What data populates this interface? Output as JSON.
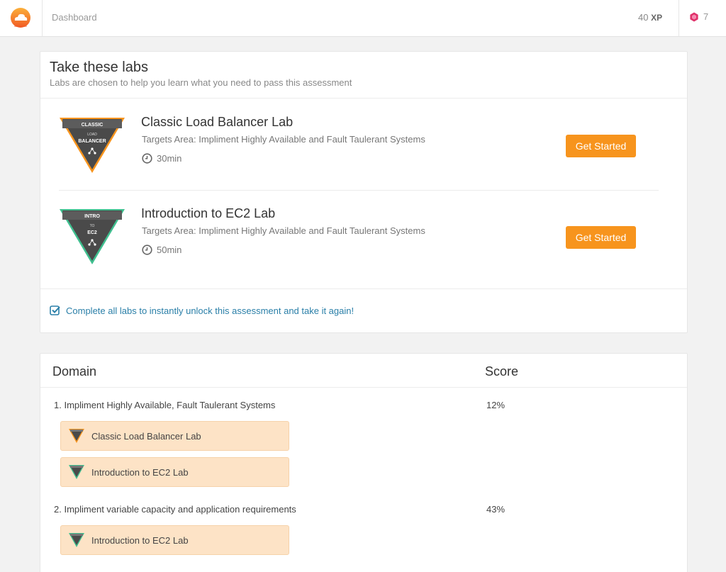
{
  "topbar": {
    "breadcrumb": "Dashboard",
    "xp_value": "40",
    "xp_unit": "XP",
    "gems": "7"
  },
  "labs_panel": {
    "title": "Take these labs",
    "subtitle": "Labs are chosen to help you learn what you need to pass this assessment",
    "labs": [
      {
        "badge_top": "CLASSIC",
        "badge_mid": "LOAD",
        "badge_bottom": "BALANCER",
        "title": "Classic Load Balancer Lab",
        "target": "Targets Area: Impliment Highly Available and Fault Taulerant Systems",
        "duration": "30min",
        "button": "Get Started",
        "accent": "#f7941d"
      },
      {
        "badge_top": "INTRO",
        "badge_mid": "TO",
        "badge_bottom": "EC2",
        "title": "Introduction to EC2 Lab",
        "target": "Targets Area: Impliment Highly Available and Fault Taulerant Systems",
        "duration": "50min",
        "button": "Get Started",
        "accent": "#3fbf8f"
      }
    ],
    "unlock_text": "Complete all labs to instantly unlock this assessment and take it again!"
  },
  "domain_table": {
    "header_domain": "Domain",
    "header_score": "Score",
    "domains": [
      {
        "name": "1. Impliment Highly Available, Fault Taulerant Systems",
        "score": "12%",
        "labs": [
          "Classic Load Balancer Lab",
          "Introduction to EC2 Lab"
        ]
      },
      {
        "name": "2. Impliment variable capacity and application requirements",
        "score": "43%",
        "labs": [
          "Introduction to EC2 Lab"
        ]
      }
    ]
  },
  "colors": {
    "button": "#f7941d",
    "chip_bg": "#fde3c6",
    "link": "#2a7fa8",
    "gem": "#e0306a"
  }
}
